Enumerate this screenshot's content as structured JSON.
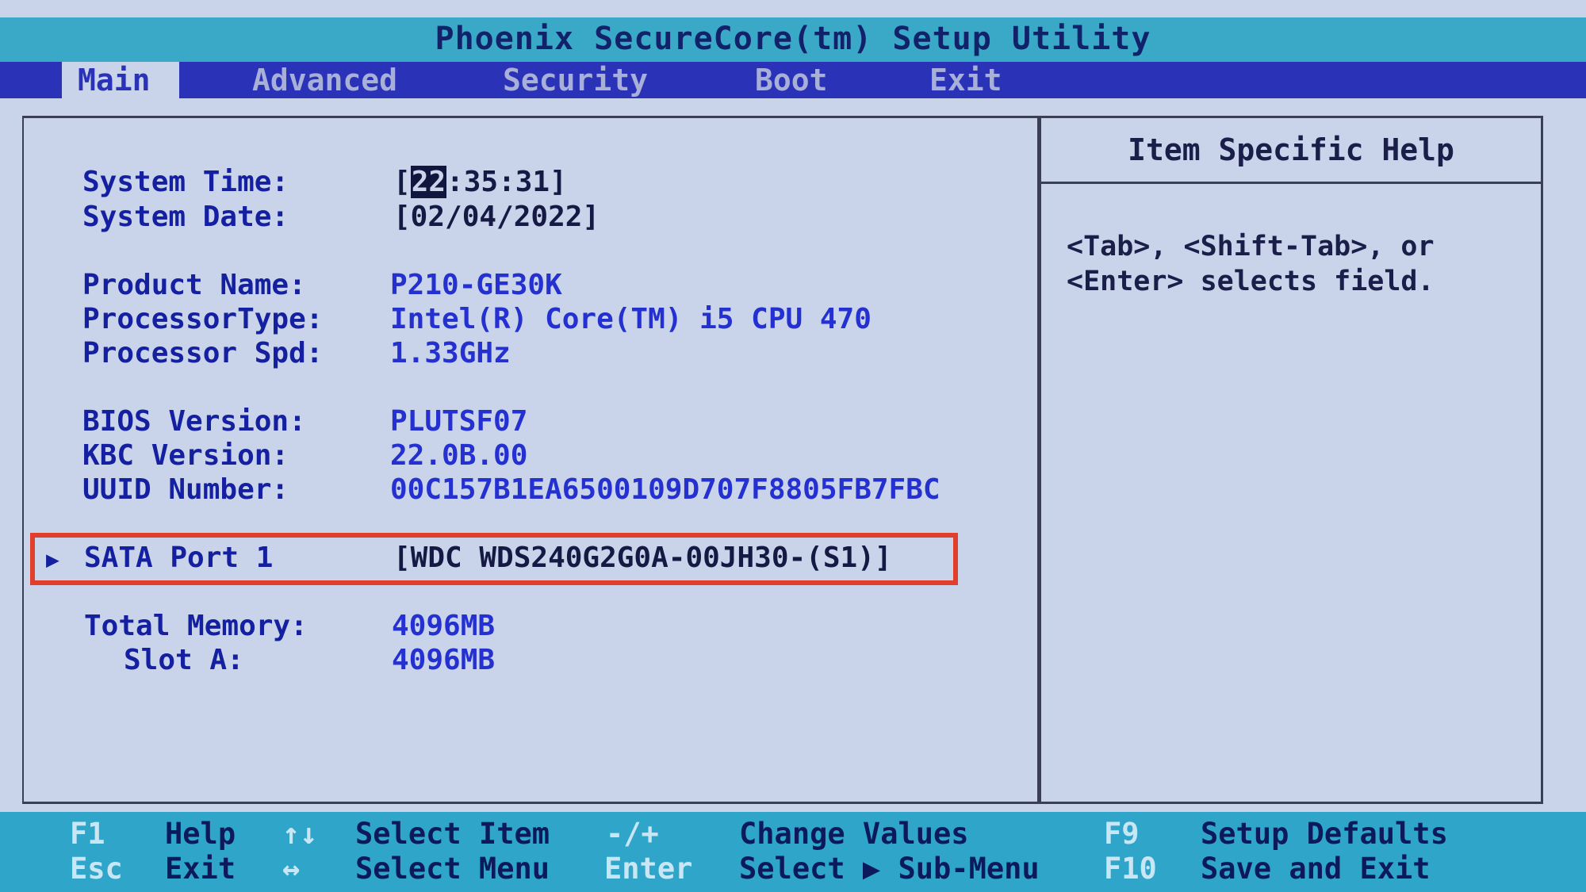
{
  "title": "Phoenix SecureCore(tm) Setup Utility",
  "tabs": [
    {
      "label": "Main"
    },
    {
      "label": "Advanced"
    },
    {
      "label": "Security"
    },
    {
      "label": "Boot"
    },
    {
      "label": "Exit"
    }
  ],
  "fields": {
    "system_time_label": "System Time:",
    "system_time_open": "[",
    "system_time_cursor": "22",
    "system_time_rest": ":35:31]",
    "system_date_label": "System Date:",
    "system_date_value": "[02/04/2022]",
    "product_name_label": "Product Name:",
    "product_name_value": "P210-GE30K",
    "processor_type_label": "ProcessorType:",
    "processor_type_value": "Intel(R) Core(TM) i5 CPU 470",
    "processor_spd_label": "Processor Spd:",
    "processor_spd_value": "1.33GHz",
    "bios_version_label": "BIOS Version:",
    "bios_version_value": "PLUTSF07",
    "kbc_version_label": "KBC Version:",
    "kbc_version_value": "22.0B.00",
    "uuid_label": "UUID Number:",
    "uuid_value": "00C157B1EA6500109D707F8805FB7FBC",
    "sata_arrow": "▶",
    "sata_label": "SATA Port 1",
    "sata_value": "[WDC WDS240G2G0A-00JH30-(S1)]",
    "total_memory_label": "Total Memory:",
    "total_memory_value": "4096MB",
    "slot_a_label": "Slot A:",
    "slot_a_value": "4096MB"
  },
  "help": {
    "title": "Item Specific Help",
    "line1": "<Tab>, <Shift-Tab>, or",
    "line2": "<Enter> selects field."
  },
  "footer": {
    "f1_key": "F1",
    "f1_desc": "Help",
    "arrows_ud_key": "↑↓",
    "arrows_ud_desc": "Select Item",
    "minus_plus_key": "-/+",
    "minus_plus_desc": "Change Values",
    "f9_key": "F9",
    "f9_desc": "Setup Defaults",
    "esc_key": "Esc",
    "esc_desc": "Exit",
    "arrows_lr_key": "↔",
    "arrows_lr_desc": "Select Menu",
    "enter_key": "Enter",
    "enter_desc": "Select ▶ Sub-Menu",
    "f10_key": "F10",
    "f10_desc": "Save and Exit"
  },
  "colors": {
    "background": "#c9d4ea",
    "menubar": "#2a33b8",
    "footer": "#2fa6c9",
    "highlight_box": "#e0402b"
  }
}
